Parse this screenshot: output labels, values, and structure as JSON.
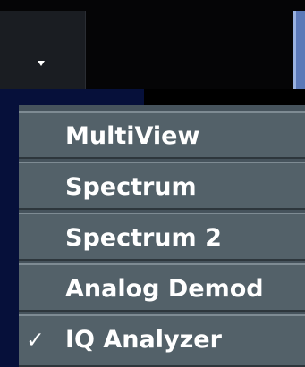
{
  "dropdown": {
    "icon": "chevron-down-icon"
  },
  "menu": {
    "items": [
      {
        "label": "MultiView",
        "checked": false
      },
      {
        "label": "Spectrum",
        "checked": false
      },
      {
        "label": "Spectrum 2",
        "checked": false
      },
      {
        "label": "Analog Demod",
        "checked": false
      },
      {
        "label": "IQ Analyzer",
        "checked": true,
        "check_mark": "✓"
      }
    ]
  },
  "colors": {
    "menu_item_bg": "#536169",
    "menu_text": "#ffffff",
    "backdrop_blue": "#06103a",
    "accent_blue": "#5b79b8"
  }
}
